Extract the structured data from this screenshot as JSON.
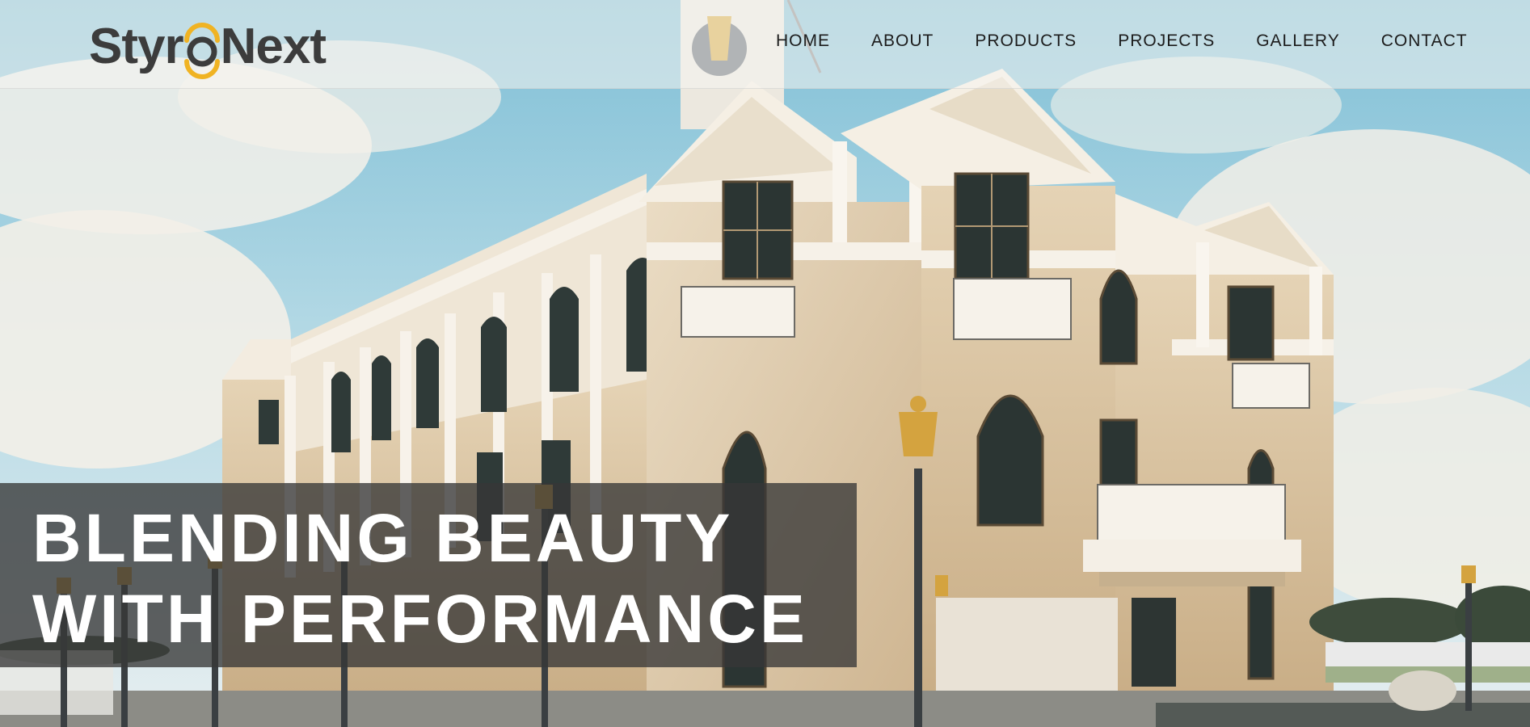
{
  "logo": {
    "part1": "Styr",
    "part2": "Next"
  },
  "nav": {
    "items": [
      "HOME",
      "ABOUT",
      "PRODUCTS",
      "PROJECTS",
      "GALLERY",
      "CONTACT"
    ]
  },
  "hero": {
    "headline_line1": "BLENDING BEAUTY",
    "headline_line2": "WITH PERFORMANCE",
    "image_description": "photo-classical-building"
  },
  "colors": {
    "logo_text": "#3c3c3c",
    "logo_accent": "#f0b323",
    "nav_text": "#1c1c1c",
    "headline_text": "#ffffff",
    "headline_bg": "#373737"
  }
}
